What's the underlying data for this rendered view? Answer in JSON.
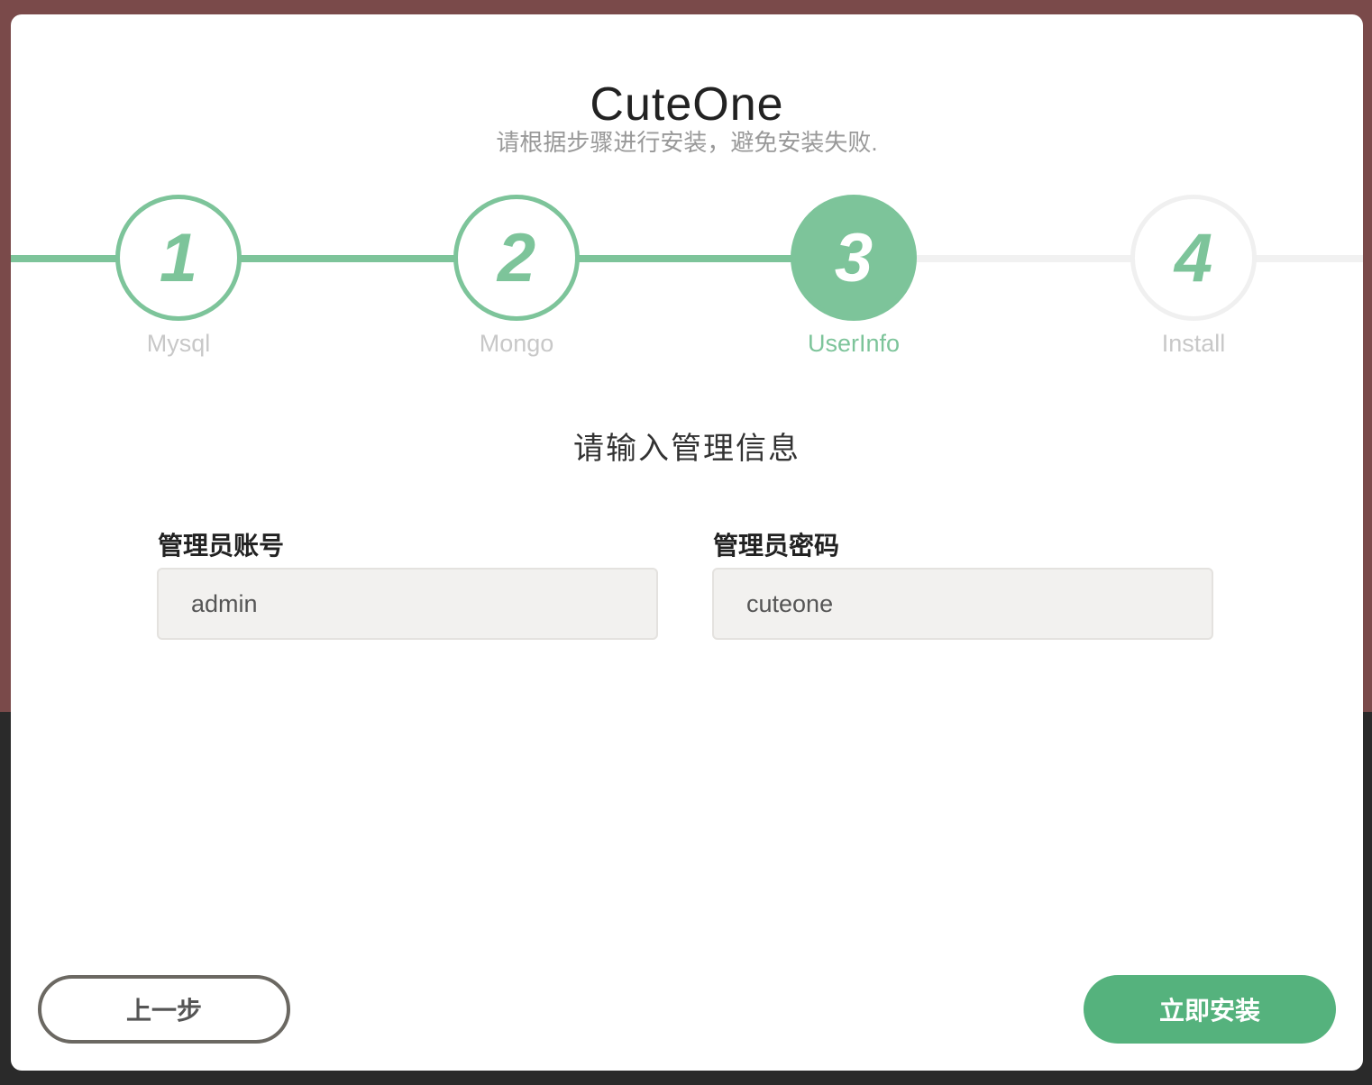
{
  "app": {
    "title": "CuteOne",
    "subtitle": "请根据步骤进行安装，避免安装失败."
  },
  "steps": [
    {
      "number": "1",
      "label": "Mysql",
      "state": "done"
    },
    {
      "number": "2",
      "label": "Mongo",
      "state": "done"
    },
    {
      "number": "3",
      "label": "UserInfo",
      "state": "active"
    },
    {
      "number": "4",
      "label": "Install",
      "state": "pending"
    }
  ],
  "form": {
    "section_title": "请输入管理信息",
    "username_label": "管理员账号",
    "username_value": "admin",
    "password_label": "管理员密码",
    "password_value": "cuteone"
  },
  "buttons": {
    "prev_label": "上一步",
    "install_label": "立即安装"
  },
  "colors": {
    "accent": "#7dc49a",
    "primary_button": "#55b27d",
    "inactive": "#f1f1f1"
  }
}
